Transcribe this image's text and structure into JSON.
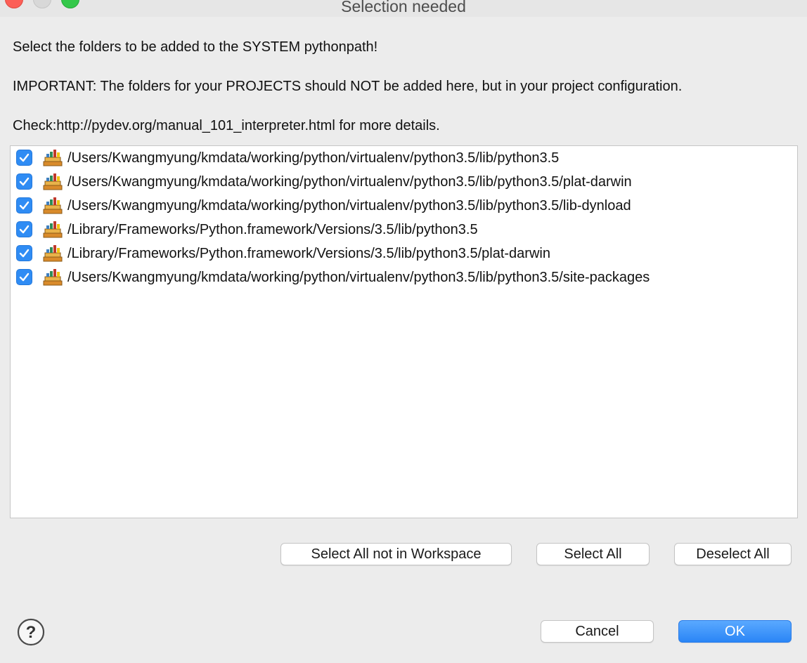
{
  "window": {
    "title": "Selection needed"
  },
  "messages": {
    "line1": "Select the folders to be added to the SYSTEM pythonpath!",
    "line2": "IMPORTANT: The folders for your PROJECTS should NOT be added here, but in your project configuration.",
    "line3": "Check:http://pydev.org/manual_101_interpreter.html for more details."
  },
  "folders": [
    {
      "path": "/Users/Kwangmyung/kmdata/working/python/virtualenv/python3.5/lib/python3.5",
      "checked": true
    },
    {
      "path": "/Users/Kwangmyung/kmdata/working/python/virtualenv/python3.5/lib/python3.5/plat-darwin",
      "checked": true
    },
    {
      "path": "/Users/Kwangmyung/kmdata/working/python/virtualenv/python3.5/lib/python3.5/lib-dynload",
      "checked": true
    },
    {
      "path": "/Library/Frameworks/Python.framework/Versions/3.5/lib/python3.5",
      "checked": true
    },
    {
      "path": "/Library/Frameworks/Python.framework/Versions/3.5/lib/python3.5/plat-darwin",
      "checked": true
    },
    {
      "path": "/Users/Kwangmyung/kmdata/working/python/virtualenv/python3.5/lib/python3.5/site-packages",
      "checked": true
    }
  ],
  "folder_icon": "python-library-folder-icon",
  "buttons": {
    "select_not_in_workspace": "Select All not in Workspace",
    "select_all": "Select All",
    "deselect_all": "Deselect All",
    "cancel": "Cancel",
    "ok": "OK"
  },
  "colors": {
    "accent": "#2f8cf4",
    "close": "#fc5f57",
    "zoom": "#34c84a"
  }
}
